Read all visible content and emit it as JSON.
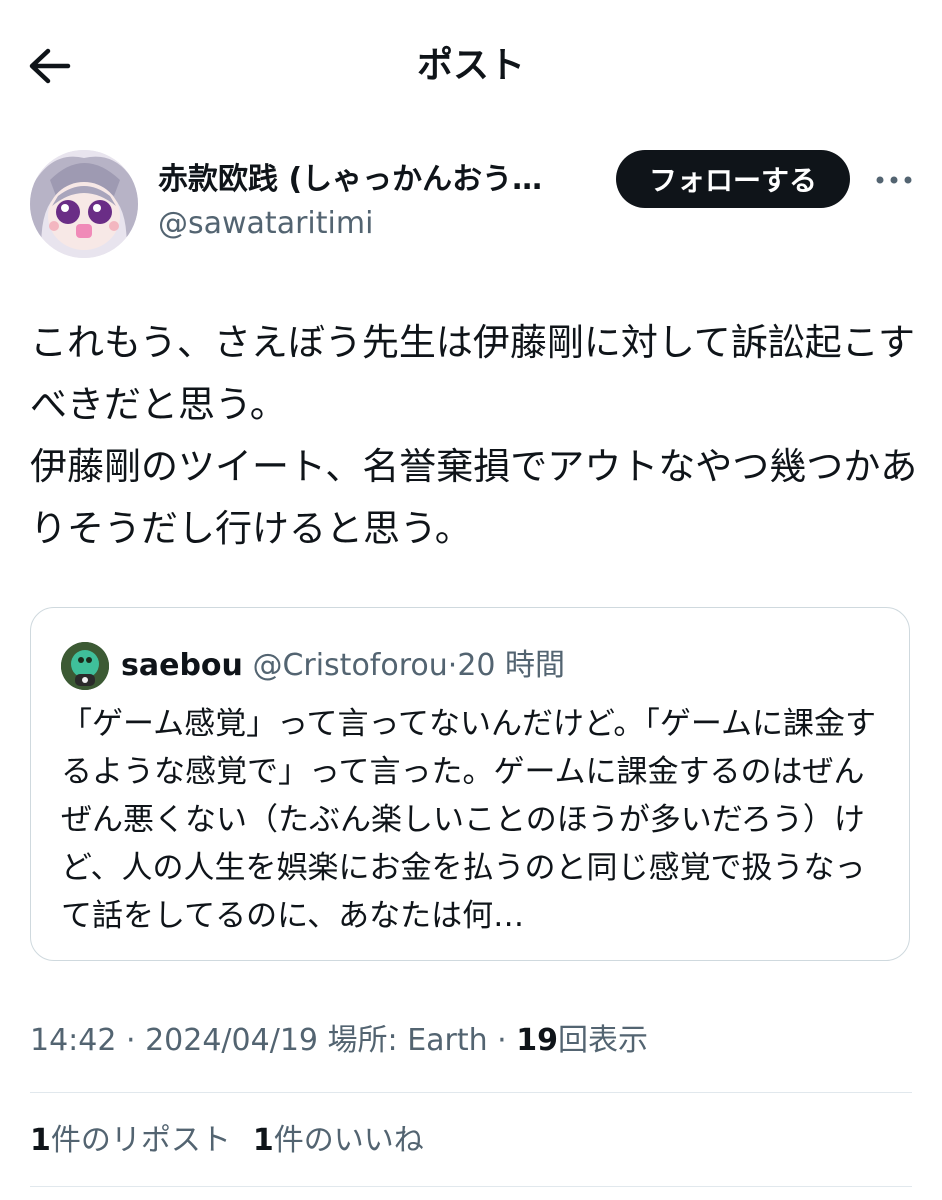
{
  "header": {
    "title": "ポスト",
    "back_icon": "arrow-left-icon"
  },
  "author": {
    "display_name": "赤款欧践 (しゃっかんおう…",
    "handle": "@sawataritimi",
    "follow_label": "フォローする",
    "more_icon": "more-horizontal-icon"
  },
  "post": {
    "text": "これもう、さえぼう先生は伊藤剛に対して訴訟起こすべきだと思う。\n伊藤剛のツイート、名誉棄損でアウトなやつ幾つかありそうだし行けると思う。"
  },
  "quote": {
    "name": "saebou",
    "handle": "@Cristoforou",
    "separator": "·",
    "time": "20 時間",
    "text": "「ゲーム感覚」って言ってないんだけど。「ゲームに課金するような感覚で」って言った。ゲームに課金するのはぜんぜん悪くない（たぶん楽しいことのほうが多いだろう）けど、人の人生を娯楽にお金を払うのと同じ感覚で扱うなって話をしてるのに、あなたは何…"
  },
  "meta": {
    "time": "14:42",
    "sep1": " · ",
    "date": "2024/04/19",
    "location_label": "場所: Earth",
    "sep2": " · ",
    "views_count": "19",
    "views_label": "回表示"
  },
  "stats": {
    "reposts_count": "1",
    "reposts_label": "件のリポスト",
    "likes_count": "1",
    "likes_label": "件のいいね"
  },
  "colors": {
    "text": "#0f1419",
    "secondary": "#536471",
    "border": "#cfd9de",
    "follow_bg": "#0f1419"
  }
}
